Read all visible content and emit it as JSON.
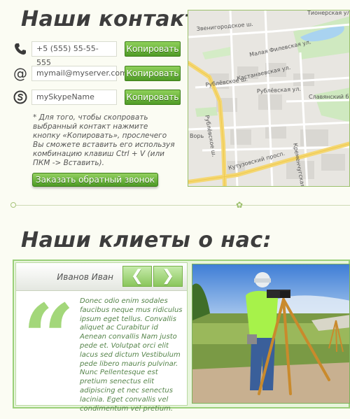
{
  "contacts": {
    "title": "Наши контакты:",
    "phone": {
      "icon": "phone-icon",
      "value": "+5 (555) 55-55-555",
      "button": "Копировать"
    },
    "email": {
      "icon": "at-icon",
      "value": "mymail@myserver.com",
      "button": "Копировать"
    },
    "skype": {
      "icon": "skype-icon",
      "value": "mySkypeName",
      "button": "Копировать"
    },
    "hint": "* Для того, чтобы скопровать выбранный контакт нажмите кнопку «Копировать», прослечего Вы сможете вставить его используя комбинацию клавиш Ctrl + V (или ПКМ -> Вставить).",
    "callback_button": "Заказать обратный звонок"
  },
  "map": {
    "labels": {
      "zvenigorod": "Звенигородское ш.",
      "filev": "Малая Филевская ул.",
      "kastan": "Кастанаевская ул.",
      "rublev_ul": "Рублёвское ш.",
      "rublev_ul2": "Рублёвская ул.",
      "slavyan": "Славянский бул.",
      "rublev_v": "Рублёвское ш.",
      "kutuz": "Кутузовский просп.",
      "krem": "Кременчугская ул.",
      "vor": "Ворь",
      "tion": "Тионерская ул.",
      "bottom": "Рублёвское ш."
    }
  },
  "reviews": {
    "title": "Наши клиеты о нас:",
    "author": "Иванов Иван",
    "prev": "❮",
    "next": "❯",
    "quote_mark": "“",
    "text": "Donec odio enim sodales faucibus neque mus ridiculus ipsum eget tellus. Convallis aliquet ac Curabitur id Aenean convallis Nam justo pede et. Volutpat orci elit lacus sed dictum Vestibulum pede libero mauris pulvinar. Nunc Pellentesque est pretium senectus elit adipiscing et nec senectus lacinia. Eget convallis vel condimentum vel pretium."
  },
  "colors": {
    "accent_green": "#5aa62e",
    "panel_green": "#9bd07a",
    "heading": "#3d3d3d"
  }
}
